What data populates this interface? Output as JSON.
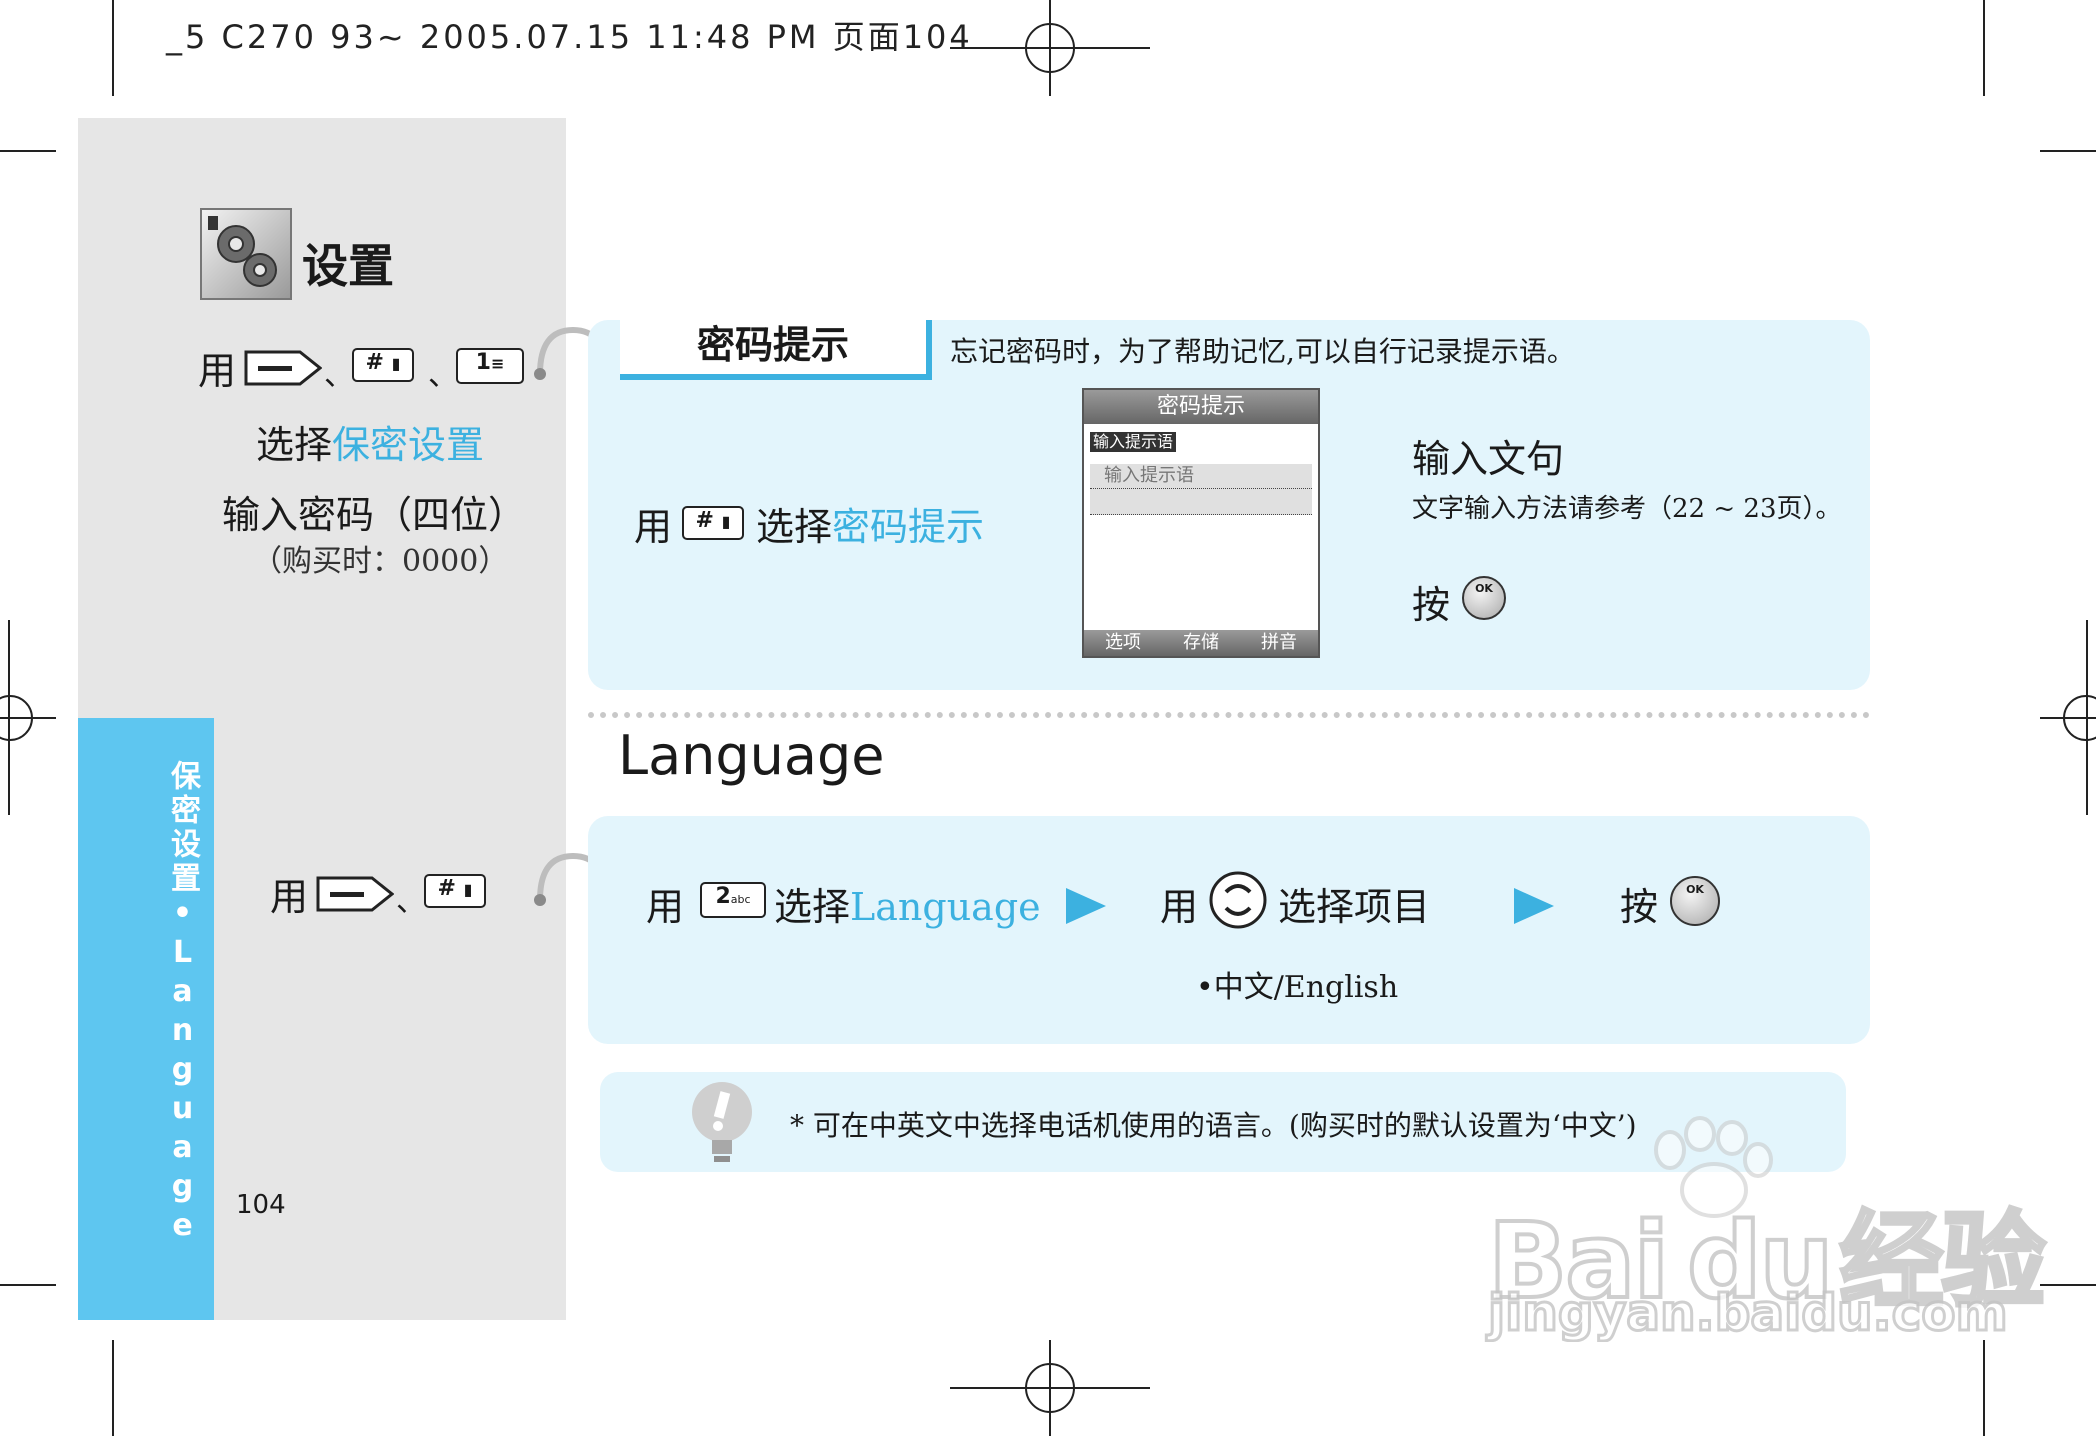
{
  "header": {
    "print_info": "_5 C270 93~ 2005.07.15 11:48 PM 页面104"
  },
  "sidebar": {
    "chapter_title": "设置",
    "step1_prefix": "用",
    "sep1": "、",
    "sep2": "、",
    "step2_prefix": "选择",
    "step2_link": "保密设置",
    "step3": "输入密码（四位）",
    "step3_note": "（购买时：0000）",
    "step4_prefix": "用",
    "sep3": "、",
    "vertical_tab": "保密设置•Language",
    "page_number": "104"
  },
  "keys": {
    "hash": "#",
    "one": "1",
    "two": "2",
    "two_sub": "abc",
    "ok": "OK"
  },
  "section1": {
    "title": "密码提示",
    "description": "忘记密码时，为了帮助记忆,可以自行记录提示语。",
    "instr_prefix": "用",
    "instr_mid": "选择",
    "instr_link": "密码提示",
    "right_title": "输入文句",
    "right_note": "文字输入方法请参考（22 ~ 23页）。",
    "press": "按"
  },
  "phone_screen": {
    "title": "密码提示",
    "field_label": "输入提示语",
    "field_value": "输入提示语",
    "softkeys": [
      "选项",
      "存储",
      "拼音"
    ]
  },
  "section2": {
    "title": "Language",
    "step1_prefix": "用",
    "step1_mid": "选择",
    "step1_link": "Language",
    "step2_prefix": "用",
    "step2_text": "选择项目",
    "step3": "按",
    "options": "中文/English"
  },
  "tip": {
    "text": "* 可在中英文中选择电话机使用的语言。(购买时的默认设置为‘中文’)"
  },
  "watermark": {
    "brand": "Bai",
    "brand2": "du",
    "cn": "经验",
    "url": "jingyan.baidu.com"
  },
  "colors": {
    "accent": "#3cb1e0",
    "tab": "#5ec6f0",
    "panel": "#e3f5fc",
    "sidebar": "#e6e6e6"
  }
}
